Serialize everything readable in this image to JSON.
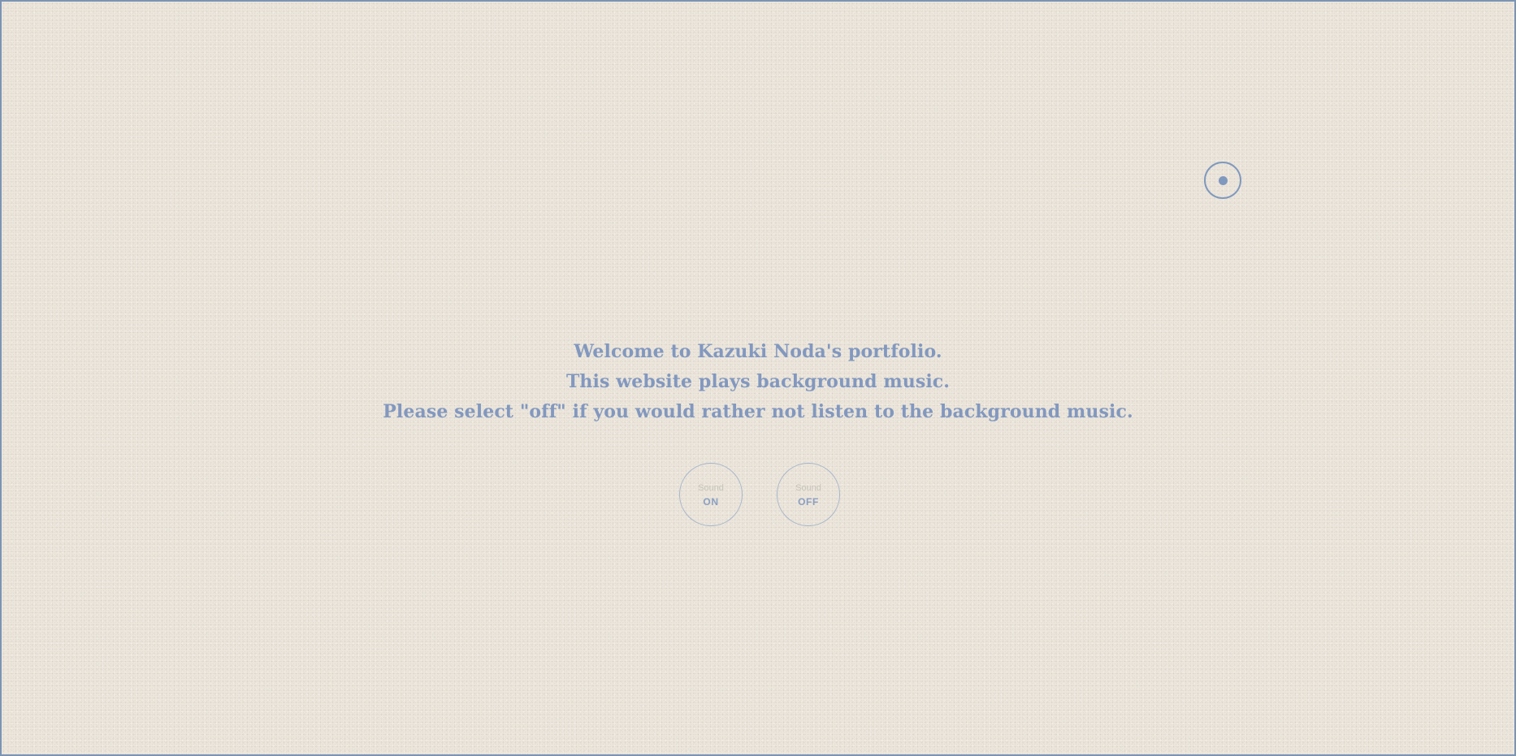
{
  "welcome": {
    "line1": "Welcome to Kazuki Noda's portfolio.",
    "line2": "This website plays background music.",
    "line3": "Please select \"off\" if you would rather not listen to the background music."
  },
  "sound_on": {
    "label": "Sound",
    "state": "ON"
  },
  "sound_off": {
    "label": "Sound",
    "state": "OFF"
  },
  "cursor": {
    "icon": "custom-cursor-icon"
  },
  "colors": {
    "accent": "#8298bf",
    "background": "#ece6dc",
    "frame": "#7c94b4"
  }
}
